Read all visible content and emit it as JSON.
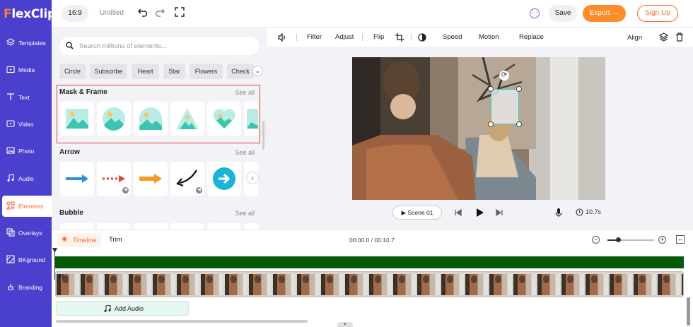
{
  "app": {
    "logo_letter": "F",
    "logo_rest": "lexClip"
  },
  "sidebar": {
    "items": [
      {
        "label": "Templates",
        "icon": "layers-icon"
      },
      {
        "label": "Media",
        "icon": "folder-icon"
      },
      {
        "label": "Text",
        "icon": "text-icon"
      },
      {
        "label": "Video",
        "icon": "video-icon"
      },
      {
        "label": "Photo",
        "icon": "photo-icon"
      },
      {
        "label": "Audio",
        "icon": "music-icon"
      },
      {
        "label": "Elements",
        "icon": "elements-icon",
        "active": true
      },
      {
        "label": "Overlays",
        "icon": "overlays-icon"
      },
      {
        "label": "BKground",
        "icon": "background-icon"
      },
      {
        "label": "Branding",
        "icon": "branding-icon"
      }
    ]
  },
  "header": {
    "ratio": "16:9",
    "title": "Untitled",
    "save_label": "Save",
    "export_label": "Export →",
    "signup_label": "Sign Up"
  },
  "elements_panel": {
    "search_placeholder": "Search millions of elements...",
    "tags": [
      "Circle",
      "Subscribe",
      "Heart",
      "Star",
      "Flowers",
      "Check"
    ],
    "sections": [
      {
        "title": "Mask & Frame",
        "see_all": "See all"
      },
      {
        "title": "Arrow",
        "see_all": "See all"
      },
      {
        "title": "Bubble",
        "see_all": "See all"
      }
    ]
  },
  "toolbar": {
    "filter": "Filter",
    "adjust": "Adjust",
    "flip": "Flip",
    "speed": "Speed",
    "motion": "Motion",
    "replace": "Replace",
    "align": "Align"
  },
  "player": {
    "scene_label": "Scene 01",
    "duration": "10.7s"
  },
  "timeline": {
    "tab_label": "Timeline",
    "trim_label": "Trim",
    "time_display": "00:00.0 / 00:10.7",
    "zoom_fraction": 0.22,
    "clip_number": "01",
    "add_audio_label": "Add Audio"
  },
  "colors": {
    "sidebar": "#4b3fce",
    "accent": "#ff6a2b",
    "export": "#ff8c2a",
    "highlight": "#d9403a",
    "track": "#045a07"
  }
}
